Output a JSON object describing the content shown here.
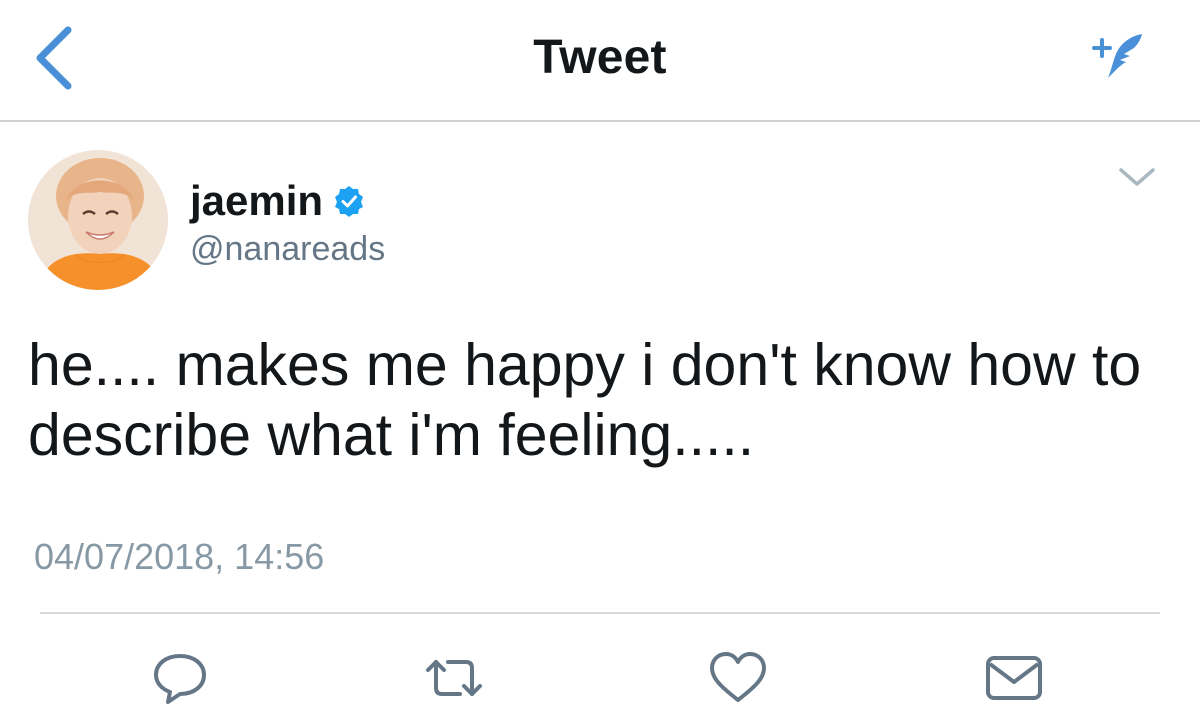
{
  "nav": {
    "title": "Tweet",
    "back_icon": "chevron-left-icon",
    "compose_icon": "compose-tweet-icon"
  },
  "tweet": {
    "author": {
      "display_name": "jaemin",
      "handle": "@nanareads",
      "verified": true,
      "avatar_icon": "avatar"
    },
    "text": "he.... makes me happy i don't know how to describe what i'm feeling.....",
    "timestamp": "04/07/2018, 14:56",
    "menu_icon": "chevron-down-icon"
  },
  "actions": [
    {
      "name": "reply",
      "icon": "reply-icon"
    },
    {
      "name": "retweet",
      "icon": "retweet-icon"
    },
    {
      "name": "like",
      "icon": "heart-icon"
    },
    {
      "name": "direct-message",
      "icon": "envelope-icon"
    }
  ],
  "colors": {
    "accent": "#4a90d9",
    "text_primary": "#14171a",
    "text_secondary": "#657786",
    "icon_gray": "#657786",
    "divider": "#d6dadd",
    "verified": "#1da1f2"
  }
}
